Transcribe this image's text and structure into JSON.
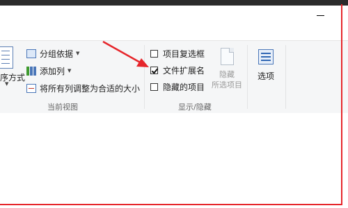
{
  "window": {
    "minimize_glyph": "—"
  },
  "ribbon": {
    "current_view": {
      "sort_label": "序方式",
      "group_by_label": "分组依据",
      "add_column_label": "添加列",
      "fit_columns_label": "将所有列调整为合适的大小",
      "group_label": "当前视图"
    },
    "show_hide": {
      "item_checkboxes": {
        "label": "项目复选框",
        "checked": false
      },
      "file_name_extensions": {
        "label": "文件扩展名",
        "checked": true
      },
      "hidden_items": {
        "label": "隐藏的项目",
        "checked": false
      },
      "hide_selected_line1": "隐藏",
      "hide_selected_line2": "所选项目",
      "group_label": "显示/隐藏"
    },
    "options": {
      "label": "选项"
    }
  },
  "annotation": {
    "color": "#e6262b"
  },
  "colors": {
    "ribbon_bg": "#f5f6f7",
    "title_bar": "#2b2b2b",
    "accent_blue": "#4a76b8"
  }
}
